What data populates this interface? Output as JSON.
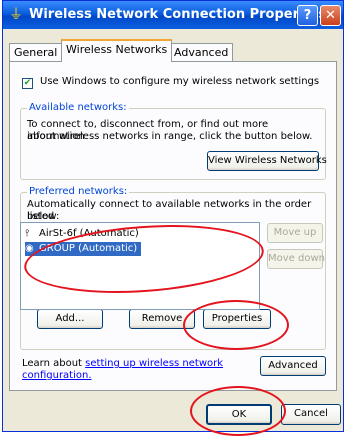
{
  "window": {
    "title": "Wireless Network Connection Properties"
  },
  "tabs": [
    {
      "label": "General"
    },
    {
      "label": "Wireless Networks"
    },
    {
      "label": "Advanced"
    }
  ],
  "use_windows_checkbox": {
    "label": "Use Windows to configure my wireless network settings",
    "checked": true
  },
  "available": {
    "legend": "Available networks:",
    "description_line1": "To connect to, disconnect from, or find out more information",
    "description_line2": "about wireless networks in range, click the button below.",
    "view_button": "View Wireless Networks"
  },
  "preferred": {
    "legend": "Preferred networks:",
    "description_line1": "Automatically connect to available networks in the order listed",
    "description_line2": "below:",
    "items": [
      {
        "label": "AirSt-6f (Automatic)",
        "icon": "antenna-icon",
        "selected": false
      },
      {
        "label": "GROUP (Automatic)",
        "icon": "wireless-network-icon",
        "selected": true
      }
    ],
    "move_up": "Move up",
    "move_down": "Move down",
    "add": "Add...",
    "remove": "Remove",
    "properties": "Properties"
  },
  "learn": {
    "prefix": "Learn about",
    "link_line1": "setting up wireless network",
    "link_line2": "configuration."
  },
  "advanced_button": "Advanced",
  "ok_button": "OK",
  "cancel_button": "Cancel",
  "colors": {
    "titlebar": "#0a5ddc",
    "annotation": "#e3141e",
    "selection": "#316ac5"
  }
}
